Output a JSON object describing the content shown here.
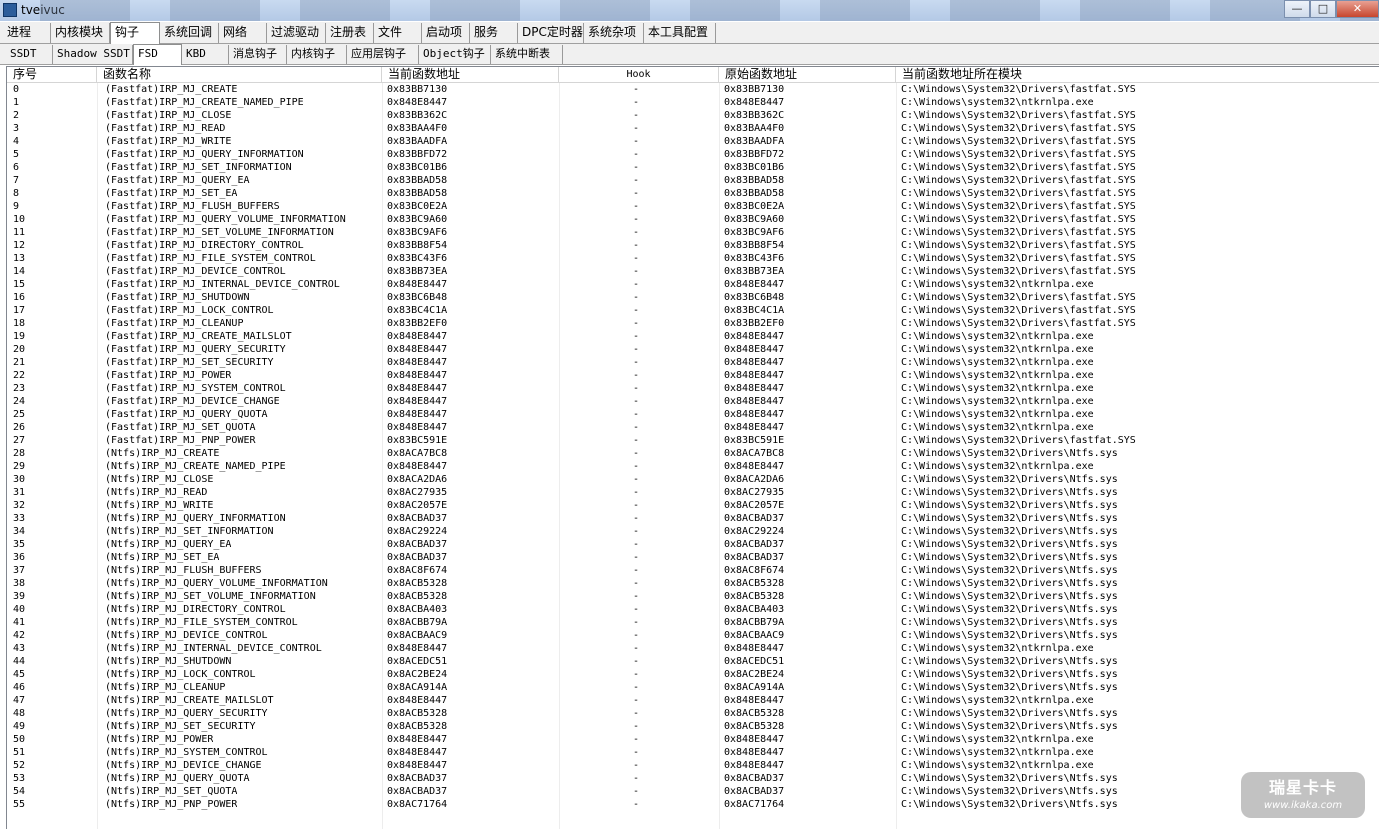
{
  "window": {
    "title": "tveivuc",
    "minimize": "—",
    "maximize": "□",
    "close": "✕"
  },
  "top_tabs": [
    "进程",
    "内核模块",
    "钩子",
    "系统回调",
    "网络",
    "过滤驱动",
    "注册表",
    "文件",
    "启动项",
    "服务",
    "DPC定时器",
    "系统杂项",
    "本工具配置"
  ],
  "sub_tabs": [
    "SSDT",
    "Shadow SSDT",
    "FSD",
    "KBD",
    "消息钩子",
    "内核钩子",
    "应用层钩子",
    "Object钩子",
    "系统中断表"
  ],
  "columns": [
    "序号",
    "函数名称",
    "当前函数地址",
    "Hook",
    "原始函数地址",
    "当前函数地址所在模块"
  ],
  "rows": [
    [
      "0",
      "(Fastfat)IRP_MJ_CREATE",
      "0x83BB7130",
      "-",
      "0x83BB7130",
      "C:\\Windows\\System32\\Drivers\\fastfat.SYS"
    ],
    [
      "1",
      "(Fastfat)IRP_MJ_CREATE_NAMED_PIPE",
      "0x848E8447",
      "-",
      "0x848E8447",
      "C:\\Windows\\system32\\ntkrnlpa.exe"
    ],
    [
      "2",
      "(Fastfat)IRP_MJ_CLOSE",
      "0x83BB362C",
      "-",
      "0x83BB362C",
      "C:\\Windows\\System32\\Drivers\\fastfat.SYS"
    ],
    [
      "3",
      "(Fastfat)IRP_MJ_READ",
      "0x83BAA4F0",
      "-",
      "0x83BAA4F0",
      "C:\\Windows\\System32\\Drivers\\fastfat.SYS"
    ],
    [
      "4",
      "(Fastfat)IRP_MJ_WRITE",
      "0x83BAADFA",
      "-",
      "0x83BAADFA",
      "C:\\Windows\\System32\\Drivers\\fastfat.SYS"
    ],
    [
      "5",
      "(Fastfat)IRP_MJ_QUERY_INFORMATION",
      "0x83BBFD72",
      "-",
      "0x83BBFD72",
      "C:\\Windows\\System32\\Drivers\\fastfat.SYS"
    ],
    [
      "6",
      "(Fastfat)IRP_MJ_SET_INFORMATION",
      "0x83BC01B6",
      "-",
      "0x83BC01B6",
      "C:\\Windows\\System32\\Drivers\\fastfat.SYS"
    ],
    [
      "7",
      "(Fastfat)IRP_MJ_QUERY_EA",
      "0x83BBAD58",
      "-",
      "0x83BBAD58",
      "C:\\Windows\\System32\\Drivers\\fastfat.SYS"
    ],
    [
      "8",
      "(Fastfat)IRP_MJ_SET_EA",
      "0x83BBAD58",
      "-",
      "0x83BBAD58",
      "C:\\Windows\\System32\\Drivers\\fastfat.SYS"
    ],
    [
      "9",
      "(Fastfat)IRP_MJ_FLUSH_BUFFERS",
      "0x83BC0E2A",
      "-",
      "0x83BC0E2A",
      "C:\\Windows\\System32\\Drivers\\fastfat.SYS"
    ],
    [
      "10",
      "(Fastfat)IRP_MJ_QUERY_VOLUME_INFORMATION",
      "0x83BC9A60",
      "-",
      "0x83BC9A60",
      "C:\\Windows\\System32\\Drivers\\fastfat.SYS"
    ],
    [
      "11",
      "(Fastfat)IRP_MJ_SET_VOLUME_INFORMATION",
      "0x83BC9AF6",
      "-",
      "0x83BC9AF6",
      "C:\\Windows\\System32\\Drivers\\fastfat.SYS"
    ],
    [
      "12",
      "(Fastfat)IRP_MJ_DIRECTORY_CONTROL",
      "0x83BB8F54",
      "-",
      "0x83BB8F54",
      "C:\\Windows\\System32\\Drivers\\fastfat.SYS"
    ],
    [
      "13",
      "(Fastfat)IRP_MJ_FILE_SYSTEM_CONTROL",
      "0x83BC43F6",
      "-",
      "0x83BC43F6",
      "C:\\Windows\\System32\\Drivers\\fastfat.SYS"
    ],
    [
      "14",
      "(Fastfat)IRP_MJ_DEVICE_CONTROL",
      "0x83BB73EA",
      "-",
      "0x83BB73EA",
      "C:\\Windows\\System32\\Drivers\\fastfat.SYS"
    ],
    [
      "15",
      "(Fastfat)IRP_MJ_INTERNAL_DEVICE_CONTROL",
      "0x848E8447",
      "-",
      "0x848E8447",
      "C:\\Windows\\system32\\ntkrnlpa.exe"
    ],
    [
      "16",
      "(Fastfat)IRP_MJ_SHUTDOWN",
      "0x83BC6B48",
      "-",
      "0x83BC6B48",
      "C:\\Windows\\System32\\Drivers\\fastfat.SYS"
    ],
    [
      "17",
      "(Fastfat)IRP_MJ_LOCK_CONTROL",
      "0x83BC4C1A",
      "-",
      "0x83BC4C1A",
      "C:\\Windows\\System32\\Drivers\\fastfat.SYS"
    ],
    [
      "18",
      "(Fastfat)IRP_MJ_CLEANUP",
      "0x83BB2EF0",
      "-",
      "0x83BB2EF0",
      "C:\\Windows\\System32\\Drivers\\fastfat.SYS"
    ],
    [
      "19",
      "(Fastfat)IRP_MJ_CREATE_MAILSLOT",
      "0x848E8447",
      "-",
      "0x848E8447",
      "C:\\Windows\\system32\\ntkrnlpa.exe"
    ],
    [
      "20",
      "(Fastfat)IRP_MJ_QUERY_SECURITY",
      "0x848E8447",
      "-",
      "0x848E8447",
      "C:\\Windows\\system32\\ntkrnlpa.exe"
    ],
    [
      "21",
      "(Fastfat)IRP_MJ_SET_SECURITY",
      "0x848E8447",
      "-",
      "0x848E8447",
      "C:\\Windows\\system32\\ntkrnlpa.exe"
    ],
    [
      "22",
      "(Fastfat)IRP_MJ_POWER",
      "0x848E8447",
      "-",
      "0x848E8447",
      "C:\\Windows\\system32\\ntkrnlpa.exe"
    ],
    [
      "23",
      "(Fastfat)IRP_MJ_SYSTEM_CONTROL",
      "0x848E8447",
      "-",
      "0x848E8447",
      "C:\\Windows\\system32\\ntkrnlpa.exe"
    ],
    [
      "24",
      "(Fastfat)IRP_MJ_DEVICE_CHANGE",
      "0x848E8447",
      "-",
      "0x848E8447",
      "C:\\Windows\\system32\\ntkrnlpa.exe"
    ],
    [
      "25",
      "(Fastfat)IRP_MJ_QUERY_QUOTA",
      "0x848E8447",
      "-",
      "0x848E8447",
      "C:\\Windows\\system32\\ntkrnlpa.exe"
    ],
    [
      "26",
      "(Fastfat)IRP_MJ_SET_QUOTA",
      "0x848E8447",
      "-",
      "0x848E8447",
      "C:\\Windows\\system32\\ntkrnlpa.exe"
    ],
    [
      "27",
      "(Fastfat)IRP_MJ_PNP_POWER",
      "0x83BC591E",
      "-",
      "0x83BC591E",
      "C:\\Windows\\System32\\Drivers\\fastfat.SYS"
    ],
    [
      "28",
      "(Ntfs)IRP_MJ_CREATE",
      "0x8ACA7BC8",
      "-",
      "0x8ACA7BC8",
      "C:\\Windows\\System32\\Drivers\\Ntfs.sys"
    ],
    [
      "29",
      "(Ntfs)IRP_MJ_CREATE_NAMED_PIPE",
      "0x848E8447",
      "-",
      "0x848E8447",
      "C:\\Windows\\system32\\ntkrnlpa.exe"
    ],
    [
      "30",
      "(Ntfs)IRP_MJ_CLOSE",
      "0x8ACA2DA6",
      "-",
      "0x8ACA2DA6",
      "C:\\Windows\\System32\\Drivers\\Ntfs.sys"
    ],
    [
      "31",
      "(Ntfs)IRP_MJ_READ",
      "0x8AC27935",
      "-",
      "0x8AC27935",
      "C:\\Windows\\System32\\Drivers\\Ntfs.sys"
    ],
    [
      "32",
      "(Ntfs)IRP_MJ_WRITE",
      "0x8AC2057E",
      "-",
      "0x8AC2057E",
      "C:\\Windows\\System32\\Drivers\\Ntfs.sys"
    ],
    [
      "33",
      "(Ntfs)IRP_MJ_QUERY_INFORMATION",
      "0x8ACBAD37",
      "-",
      "0x8ACBAD37",
      "C:\\Windows\\System32\\Drivers\\Ntfs.sys"
    ],
    [
      "34",
      "(Ntfs)IRP_MJ_SET_INFORMATION",
      "0x8AC29224",
      "-",
      "0x8AC29224",
      "C:\\Windows\\System32\\Drivers\\Ntfs.sys"
    ],
    [
      "35",
      "(Ntfs)IRP_MJ_QUERY_EA",
      "0x8ACBAD37",
      "-",
      "0x8ACBAD37",
      "C:\\Windows\\System32\\Drivers\\Ntfs.sys"
    ],
    [
      "36",
      "(Ntfs)IRP_MJ_SET_EA",
      "0x8ACBAD37",
      "-",
      "0x8ACBAD37",
      "C:\\Windows\\System32\\Drivers\\Ntfs.sys"
    ],
    [
      "37",
      "(Ntfs)IRP_MJ_FLUSH_BUFFERS",
      "0x8AC8F674",
      "-",
      "0x8AC8F674",
      "C:\\Windows\\System32\\Drivers\\Ntfs.sys"
    ],
    [
      "38",
      "(Ntfs)IRP_MJ_QUERY_VOLUME_INFORMATION",
      "0x8ACB5328",
      "-",
      "0x8ACB5328",
      "C:\\Windows\\System32\\Drivers\\Ntfs.sys"
    ],
    [
      "39",
      "(Ntfs)IRP_MJ_SET_VOLUME_INFORMATION",
      "0x8ACB5328",
      "-",
      "0x8ACB5328",
      "C:\\Windows\\System32\\Drivers\\Ntfs.sys"
    ],
    [
      "40",
      "(Ntfs)IRP_MJ_DIRECTORY_CONTROL",
      "0x8ACBA403",
      "-",
      "0x8ACBA403",
      "C:\\Windows\\System32\\Drivers\\Ntfs.sys"
    ],
    [
      "41",
      "(Ntfs)IRP_MJ_FILE_SYSTEM_CONTROL",
      "0x8ACBB79A",
      "-",
      "0x8ACBB79A",
      "C:\\Windows\\System32\\Drivers\\Ntfs.sys"
    ],
    [
      "42",
      "(Ntfs)IRP_MJ_DEVICE_CONTROL",
      "0x8ACBAAC9",
      "-",
      "0x8ACBAAC9",
      "C:\\Windows\\System32\\Drivers\\Ntfs.sys"
    ],
    [
      "43",
      "(Ntfs)IRP_MJ_INTERNAL_DEVICE_CONTROL",
      "0x848E8447",
      "-",
      "0x848E8447",
      "C:\\Windows\\system32\\ntkrnlpa.exe"
    ],
    [
      "44",
      "(Ntfs)IRP_MJ_SHUTDOWN",
      "0x8ACEDC51",
      "-",
      "0x8ACEDC51",
      "C:\\Windows\\System32\\Drivers\\Ntfs.sys"
    ],
    [
      "45",
      "(Ntfs)IRP_MJ_LOCK_CONTROL",
      "0x8AC2BE24",
      "-",
      "0x8AC2BE24",
      "C:\\Windows\\System32\\Drivers\\Ntfs.sys"
    ],
    [
      "46",
      "(Ntfs)IRP_MJ_CLEANUP",
      "0x8ACA914A",
      "-",
      "0x8ACA914A",
      "C:\\Windows\\System32\\Drivers\\Ntfs.sys"
    ],
    [
      "47",
      "(Ntfs)IRP_MJ_CREATE_MAILSLOT",
      "0x848E8447",
      "-",
      "0x848E8447",
      "C:\\Windows\\system32\\ntkrnlpa.exe"
    ],
    [
      "48",
      "(Ntfs)IRP_MJ_QUERY_SECURITY",
      "0x8ACB5328",
      "-",
      "0x8ACB5328",
      "C:\\Windows\\System32\\Drivers\\Ntfs.sys"
    ],
    [
      "49",
      "(Ntfs)IRP_MJ_SET_SECURITY",
      "0x8ACB5328",
      "-",
      "0x8ACB5328",
      "C:\\Windows\\System32\\Drivers\\Ntfs.sys"
    ],
    [
      "50",
      "(Ntfs)IRP_MJ_POWER",
      "0x848E8447",
      "-",
      "0x848E8447",
      "C:\\Windows\\system32\\ntkrnlpa.exe"
    ],
    [
      "51",
      "(Ntfs)IRP_MJ_SYSTEM_CONTROL",
      "0x848E8447",
      "-",
      "0x848E8447",
      "C:\\Windows\\system32\\ntkrnlpa.exe"
    ],
    [
      "52",
      "(Ntfs)IRP_MJ_DEVICE_CHANGE",
      "0x848E8447",
      "-",
      "0x848E8447",
      "C:\\Windows\\system32\\ntkrnlpa.exe"
    ],
    [
      "53",
      "(Ntfs)IRP_MJ_QUERY_QUOTA",
      "0x8ACBAD37",
      "-",
      "0x8ACBAD37",
      "C:\\Windows\\System32\\Drivers\\Ntfs.sys"
    ],
    [
      "54",
      "(Ntfs)IRP_MJ_SET_QUOTA",
      "0x8ACBAD37",
      "-",
      "0x8ACBAD37",
      "C:\\Windows\\System32\\Drivers\\Ntfs.sys"
    ],
    [
      "55",
      "(Ntfs)IRP_MJ_PNP_POWER",
      "0x8AC71764",
      "-",
      "0x8AC71764",
      "C:\\Windows\\System32\\Drivers\\Ntfs.sys"
    ]
  ],
  "watermark": {
    "main": "瑞星卡卡",
    "sub": "www.ikaka.com"
  }
}
